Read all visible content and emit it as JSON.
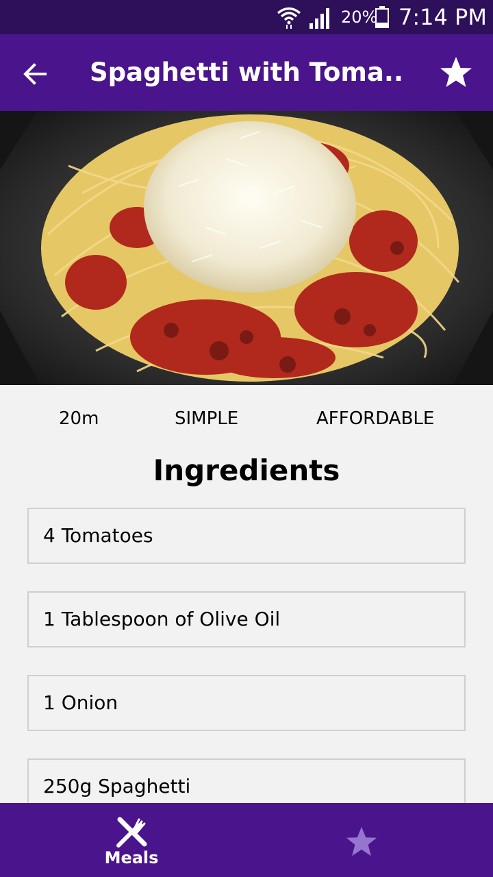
{
  "status_bar": {
    "battery_percent": "20%",
    "time": "7:14 PM"
  },
  "app_bar": {
    "title": "Spaghetti with Toma..",
    "back_icon": "arrow-left-icon",
    "favorite_icon": "star-icon"
  },
  "meal": {
    "duration": "20m",
    "complexity": "SIMPLE",
    "affordability": "AFFORDABLE"
  },
  "ingredients": {
    "heading": "Ingredients",
    "items": [
      "4 Tomatoes",
      "1 Tablespoon of Olive Oil",
      "1 Onion",
      "250g Spaghetti"
    ]
  },
  "bottom_nav": {
    "tabs": [
      {
        "label": "Meals",
        "icon": "fork-knife-icon",
        "active": true
      },
      {
        "label": "",
        "icon": "star-icon",
        "active": false
      }
    ]
  },
  "colors": {
    "primary": "#4a148c",
    "status_bar": "#2e0f5a",
    "inactive_icon": "#9575cd",
    "background": "#f2f2f2"
  }
}
